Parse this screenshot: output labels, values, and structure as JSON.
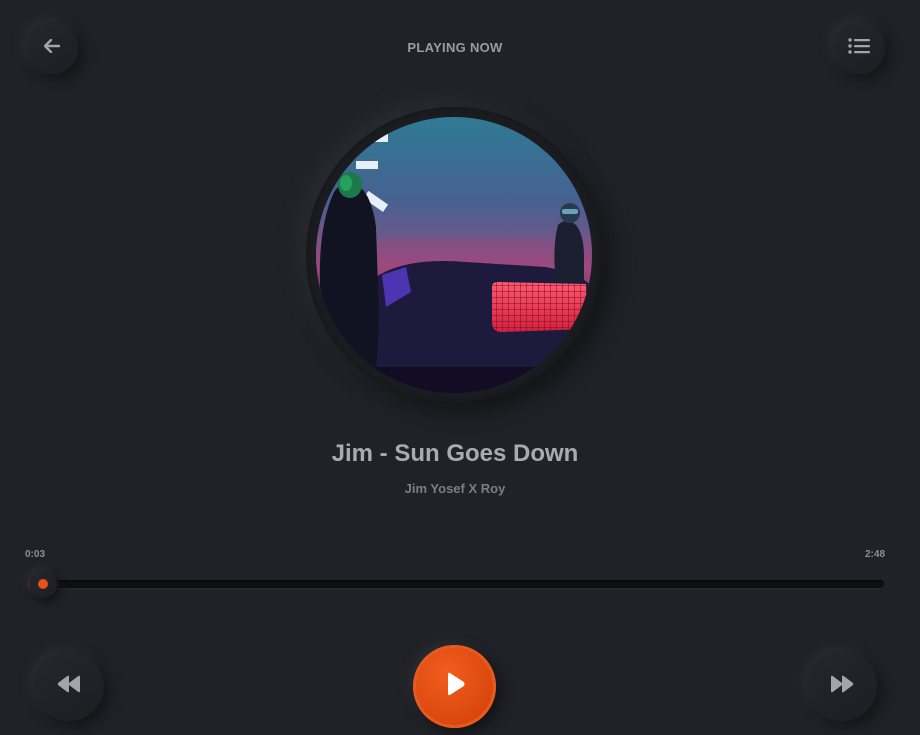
{
  "header": {
    "title": "PLAYING NOW",
    "back_icon": "arrow-left-icon",
    "menu_icon": "list-icon"
  },
  "track": {
    "title": "Jim - Sun Goes Down",
    "artist": "Jim Yosef X Roy",
    "album_art": "album-art"
  },
  "progress": {
    "current": "0:03",
    "total": "2:48",
    "fraction": 0.018
  },
  "controls": {
    "prev_icon": "rewind-icon",
    "play_icon": "play-icon",
    "next_icon": "fast-forward-icon"
  },
  "colors": {
    "background": "#202227",
    "accent": "#e4510f"
  }
}
